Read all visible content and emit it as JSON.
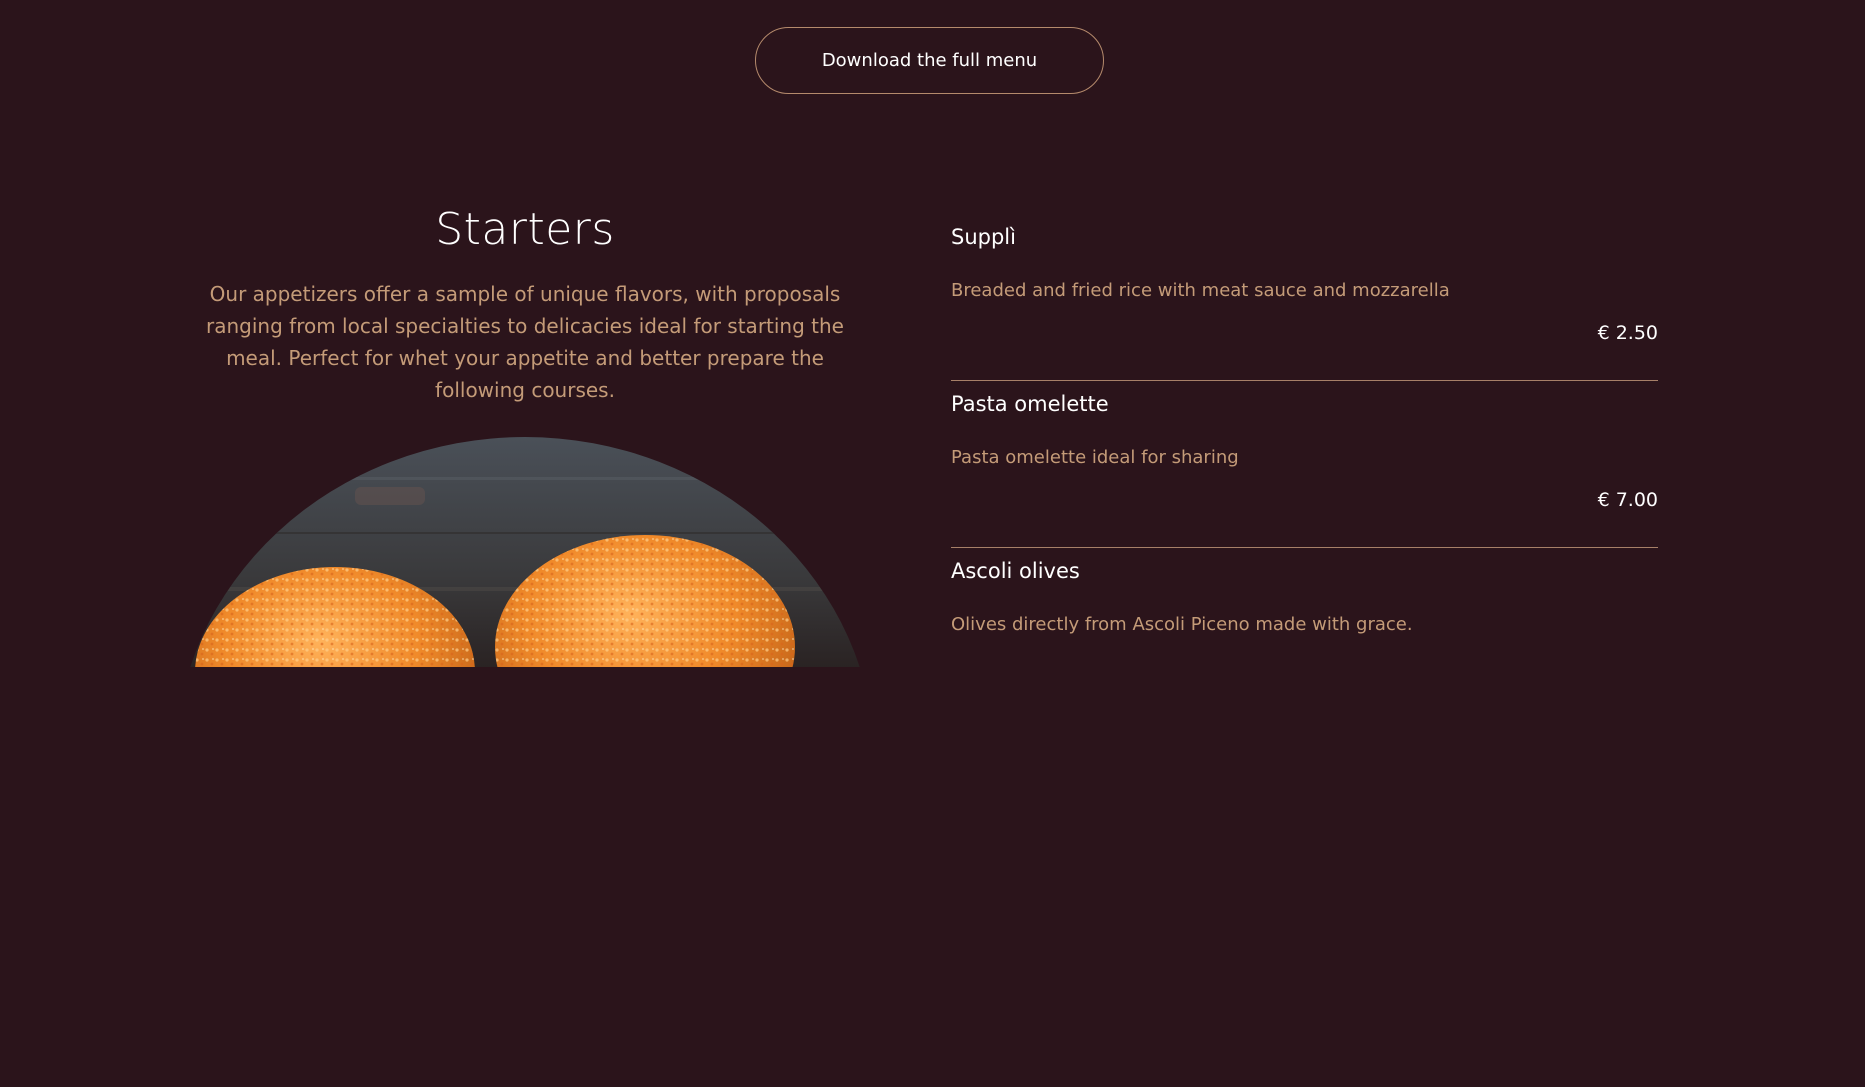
{
  "download_button": {
    "label": "Download the full menu"
  },
  "starters": {
    "title": "Starters",
    "description": "Our appetizers offer a sample of unique flavors, with proposals ranging from local specialties to delicacies ideal for starting the meal. Perfect for whet your appetite and better prepare the following courses."
  },
  "menu_items": [
    {
      "name": "Supplì",
      "description": "Breaded and fried rice with meat sauce and mozzarella",
      "price": "€ 2.50"
    },
    {
      "name": "Pasta omelette",
      "description": "Pasta omelette ideal for sharing",
      "price": "€ 7.00"
    },
    {
      "name": "Ascoli olives",
      "description": "Olives directly from Ascoli Piceno made with grace.",
      "price": ""
    }
  ],
  "colors": {
    "background": "#2b141b",
    "accent_text": "#c49b78",
    "divider": "#a78068",
    "button_border": "#b58a6c"
  },
  "photo": {
    "icon": "supplì-photo"
  }
}
